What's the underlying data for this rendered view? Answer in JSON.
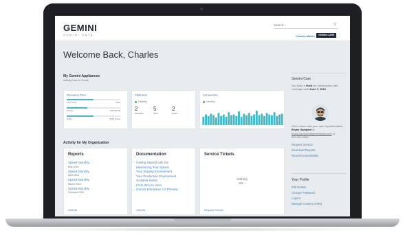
{
  "header": {
    "logo": "GEMINI",
    "logo_sub": "GEMINI DATA",
    "search_placeholder": "Search...",
    "user_name": "Charles Martin",
    "user_badge": "GEMINI CARE"
  },
  "main": {
    "welcome": "Welcome Back, Charles",
    "appliances_title": "My Gemini Appliances",
    "appliances_sub": "Activity Last 24 Hours",
    "resource_pool": {
      "title": "Resource Pool",
      "meters": [
        {
          "label": "CPU Cores",
          "value": "16/32",
          "fill": 0.5
        },
        {
          "label": "Storage",
          "value": "3.8B/10B TB",
          "fill": 0.38
        },
        {
          "label": "Nodes",
          "value": "48/96 Nodes",
          "fill": 0.5
        }
      ]
    },
    "platforms": {
      "title": "Platforms",
      "status": "Healthy",
      "stats": [
        {
          "num": "2",
          "label": "Navigation"
        },
        {
          "num": "5",
          "label": "Stitch"
        },
        {
          "num": "2",
          "label": "Marine"
        }
      ]
    },
    "connectors": {
      "title": "Connectors",
      "status": "Healthy",
      "bars": [
        0.55,
        0.7,
        0.6,
        0.75,
        0.65,
        0.5,
        0.8,
        0.6,
        0.7,
        0.55,
        0.85,
        0.65,
        0.7,
        0.6,
        0.9,
        0.55,
        0.75,
        0.65,
        0.8,
        0.6,
        0.7,
        0.95,
        0.65,
        0.75,
        0.6,
        0.8,
        0.7,
        0.65,
        0.85,
        0.6,
        0.7,
        0.75
      ]
    },
    "activity_title": "Activity for My Organization",
    "reports": {
      "title": "Reports",
      "items": [
        {
          "name": "Splunk Monthly",
          "date": "May 2018"
        },
        {
          "name": "Splunk Monthly",
          "date": "April 2018"
        },
        {
          "name": "Splunk Monthly",
          "date": "March 2018"
        },
        {
          "name": "Splunk Monthly",
          "date": "February 2018"
        }
      ],
      "footer": "View All"
    },
    "documentation": {
      "title": "Documentation",
      "items": [
        "Getting Started with GE",
        "Maximizing Your Splunk",
        "Your Staging Environment",
        "Your Production Environment",
        "Scalable Elastic",
        "From Zero to Hero",
        "Gemini Enterprise 3.0 Preview"
      ],
      "footer": "View All"
    },
    "tickets": {
      "title": "Service Tickets",
      "empty_line1": "Nothing",
      "empty_line2": "Yet...",
      "footer": "Request Service"
    }
  },
  "right_panel": {
    "care_title": "Gemini Care",
    "care_text_pre": "You have a ",
    "care_tier": "Gold",
    "care_text_mid": " tier subscription with coverage until ",
    "care_until": "June 7, 2019",
    "care_text_end": ".",
    "contact_pre": "Get in touch with your care representative, ",
    "rep_name": "Bryan Sampaol",
    "contact_at": " at ",
    "rep_email": "bryan.sampaol@geminidata.com",
    "contact_or": " or ",
    "rep_phone": "510.999.0420",
    "contact_end": ".",
    "links": [
      "Request Service",
      "Download Reports",
      "Read Documentation"
    ],
    "profile_title": "Your Profile",
    "profile_links": [
      "Edit Details",
      "Change Password",
      "Logout",
      "Manage Content (CMS)"
    ]
  }
}
